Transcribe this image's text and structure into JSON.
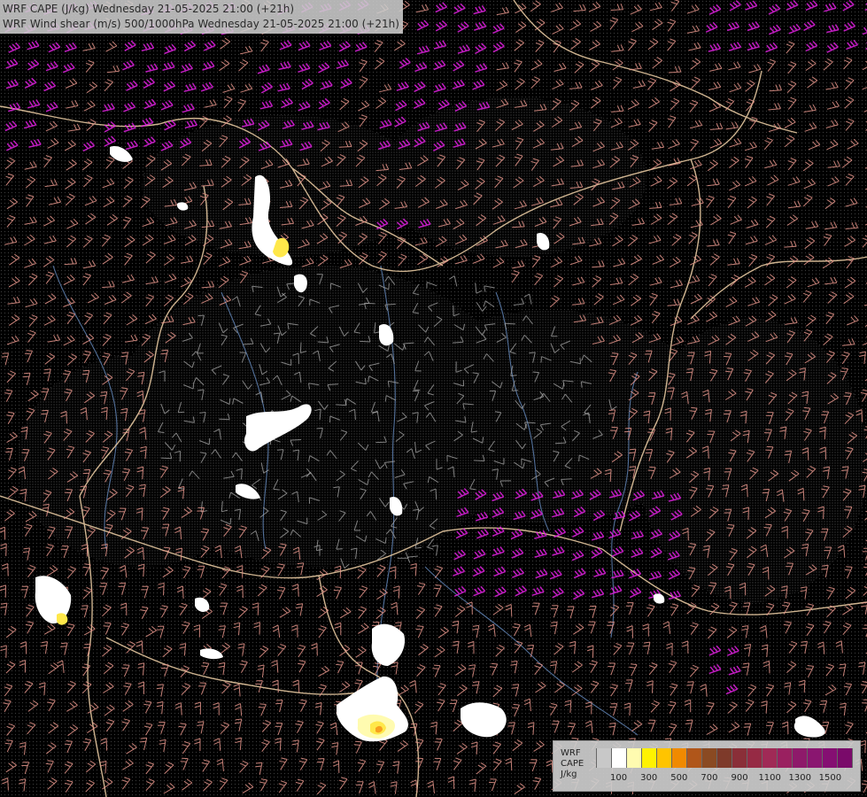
{
  "header": {
    "line1": "WRF CAPE (J/kg) Wednesday 21-05-2025 21:00 (+21h)",
    "line2": "WRF Wind shear (m/s) 500/1000hPa Wednesday 21-05-2025 21:00 (+21h)"
  },
  "legend": {
    "label_lines": [
      "WRF",
      "CAPE",
      "J/kg"
    ],
    "swatch_colors": [
      "#c8c8c8",
      "#ffffff",
      "#fffbb0",
      "#fff200",
      "#ffc400",
      "#f08a00",
      "#b0561a",
      "#8a4a22",
      "#7e3a2a",
      "#8a2f38",
      "#962a44",
      "#a02a56",
      "#9a2060",
      "#8e1a6a",
      "#8a1670",
      "#850f72",
      "#7a0a6a"
    ],
    "tick_labels": [
      "100",
      "300",
      "500",
      "700",
      "900",
      "1100",
      "1300",
      "1500"
    ]
  },
  "colors": {
    "background": "#000000",
    "border_tan": "#e6c8a0",
    "river": "#5f82b4",
    "barb_pink": "#e8968c",
    "barb_magenta": "#e020e0",
    "barb_gray": "#aaaaaa",
    "cape_white": "#ffffff",
    "cape_yellow": "#ffe84a",
    "cape_orange": "#f7a020"
  }
}
